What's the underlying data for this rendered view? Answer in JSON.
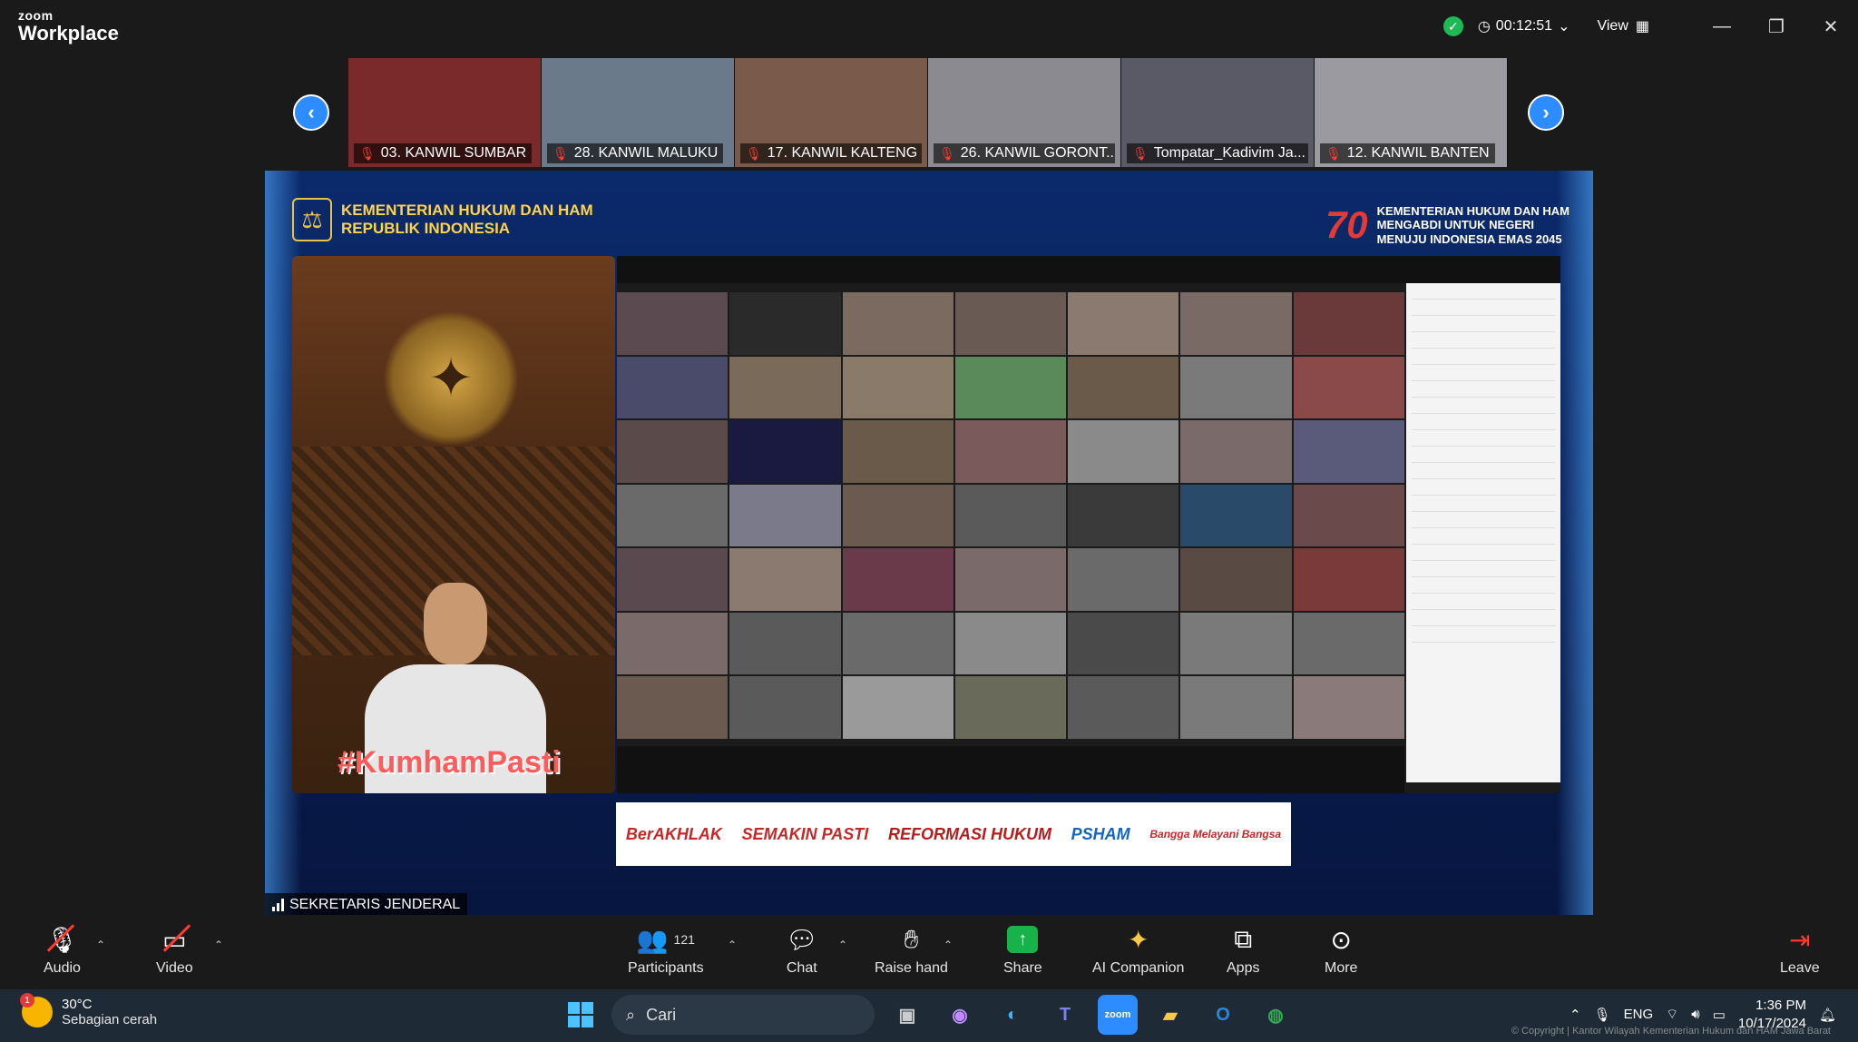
{
  "app": {
    "brand_top": "zoom",
    "brand_bottom": "Workplace"
  },
  "titlebar": {
    "timer": "00:12:51",
    "view_label": "View"
  },
  "thumbnails": [
    {
      "label": "03. KANWIL SUMBAR",
      "bg": "#7a2a2a"
    },
    {
      "label": "28. KANWIL MALUKU",
      "bg": "#6b7a8a"
    },
    {
      "label": "17. KANWIL KALTENG",
      "bg": "#7a5a4a"
    },
    {
      "label": "26. KANWIL GORONT...",
      "bg": "#8a8a90"
    },
    {
      "label": "Tompatar_Kadivim Ja...",
      "bg": "#5a5a66"
    },
    {
      "label": "12. KANWIL BANTEN",
      "bg": "#9a9aa0"
    }
  ],
  "share": {
    "header_left_line1": "KEMENTERIAN HUKUM DAN HAM",
    "header_left_line2": "REPUBLIK INDONESIA",
    "header_right_num": "70",
    "header_right_line1": "KEMENTERIAN HUKUM DAN HAM",
    "header_right_line2": "MENGABDI UNTUK NEGERI",
    "header_right_line3": "MENUJU INDONESIA EMAS 2045",
    "hashtag": "#KumhamPasti",
    "logos": [
      "BerAKHLAK",
      "SEMAKIN PASTI",
      "REFORMASI HUKUM",
      "PSHAM",
      "Bangga Melayani Bangsa"
    ]
  },
  "speaker_name": "SEKRETARIS JENDERAL",
  "toolbar": {
    "audio": "Audio",
    "video": "Video",
    "participants": "Participants",
    "participants_count": "121",
    "chat": "Chat",
    "raise_hand": "Raise hand",
    "share": "Share",
    "ai_companion": "AI Companion",
    "apps": "Apps",
    "more": "More",
    "leave": "Leave"
  },
  "taskbar": {
    "temp": "30°C",
    "weather": "Sebagian cerah",
    "weather_badge": "1",
    "search_placeholder": "Cari",
    "lang": "ENG",
    "time": "1:36 PM",
    "date": "10/17/2024",
    "copyright": "© Copyright | Kantor Wilayah Kementerian Hukum dan HAM Jawa Barat"
  },
  "colors": {
    "accent": "#2d8cff",
    "share_green": "#18b24b",
    "danger": "#ff3b30"
  }
}
